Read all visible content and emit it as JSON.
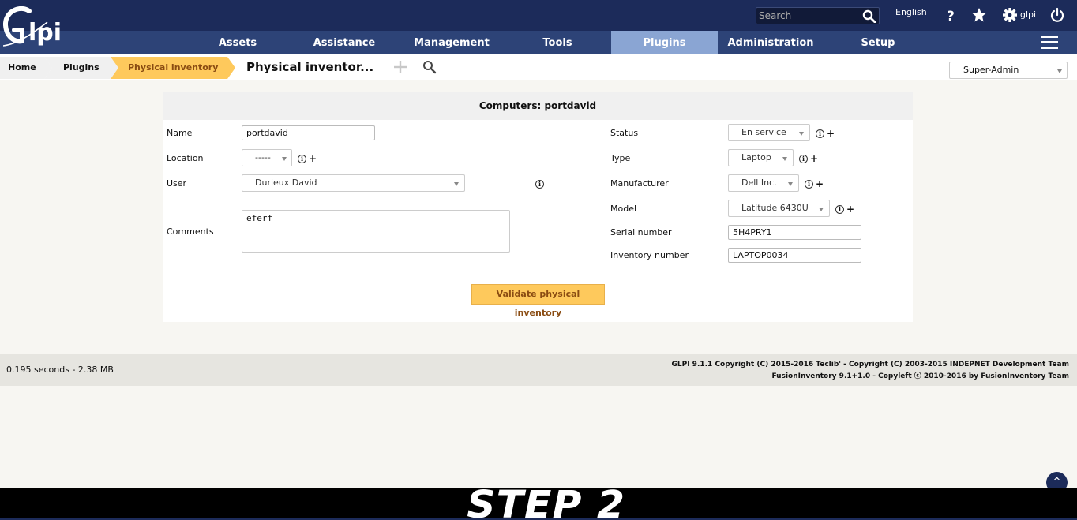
{
  "header": {
    "logo_text": "Glpi",
    "search_placeholder": "Search",
    "language": "English",
    "user": "glpi"
  },
  "menu": {
    "items": [
      {
        "label": "Assets"
      },
      {
        "label": "Assistance"
      },
      {
        "label": "Management"
      },
      {
        "label": "Tools"
      },
      {
        "label": "Plugins",
        "active": true
      },
      {
        "label": "Administration"
      },
      {
        "label": "Setup"
      }
    ]
  },
  "breadcrumb": {
    "items": [
      {
        "label": "Home"
      },
      {
        "label": "Plugins"
      },
      {
        "label": "Physical inventory"
      }
    ],
    "page_title": "Physical inventor..."
  },
  "profile": {
    "selected": "Super-Admin"
  },
  "form": {
    "title": "Computers: portdavid",
    "name": {
      "label": "Name",
      "value": "portdavid"
    },
    "location": {
      "label": "Location",
      "value": "-----"
    },
    "user": {
      "label": "User",
      "value": "Durieux David"
    },
    "comments": {
      "label": "Comments",
      "value": "eferf"
    },
    "status": {
      "label": "Status",
      "value": "En service"
    },
    "type": {
      "label": "Type",
      "value": "Laptop"
    },
    "manufacturer": {
      "label": "Manufacturer",
      "value": "Dell Inc."
    },
    "model": {
      "label": "Model",
      "value": "Latitude 6430U"
    },
    "serial": {
      "label": "Serial number",
      "value": "5H4PRY1"
    },
    "inventory_number": {
      "label": "Inventory number",
      "value": "LAPTOP0034"
    },
    "validate_label": "Validate physical inventory"
  },
  "footer": {
    "timing": "0.195 seconds - 2.38 MB",
    "copyright_glpi": "GLPI 9.1.1 Copyright (C) 2015-2016 Teclib' - Copyright (C) 2003-2015 INDEPNET Development Team",
    "copyright_fusion": "FusionInventory 9.1+1.0 - Copyleft ⓒ 2010-2016 by FusionInventory Team"
  },
  "back_to_top": "^",
  "overlay": {
    "step_text": "STEP 2"
  },
  "colors": {
    "header": "#1c2b5a",
    "menu": "#2d4377",
    "menu_active": "#8aa5d3",
    "breadcrumb_active": "#fec95c",
    "validate_button": "#fec95c"
  }
}
